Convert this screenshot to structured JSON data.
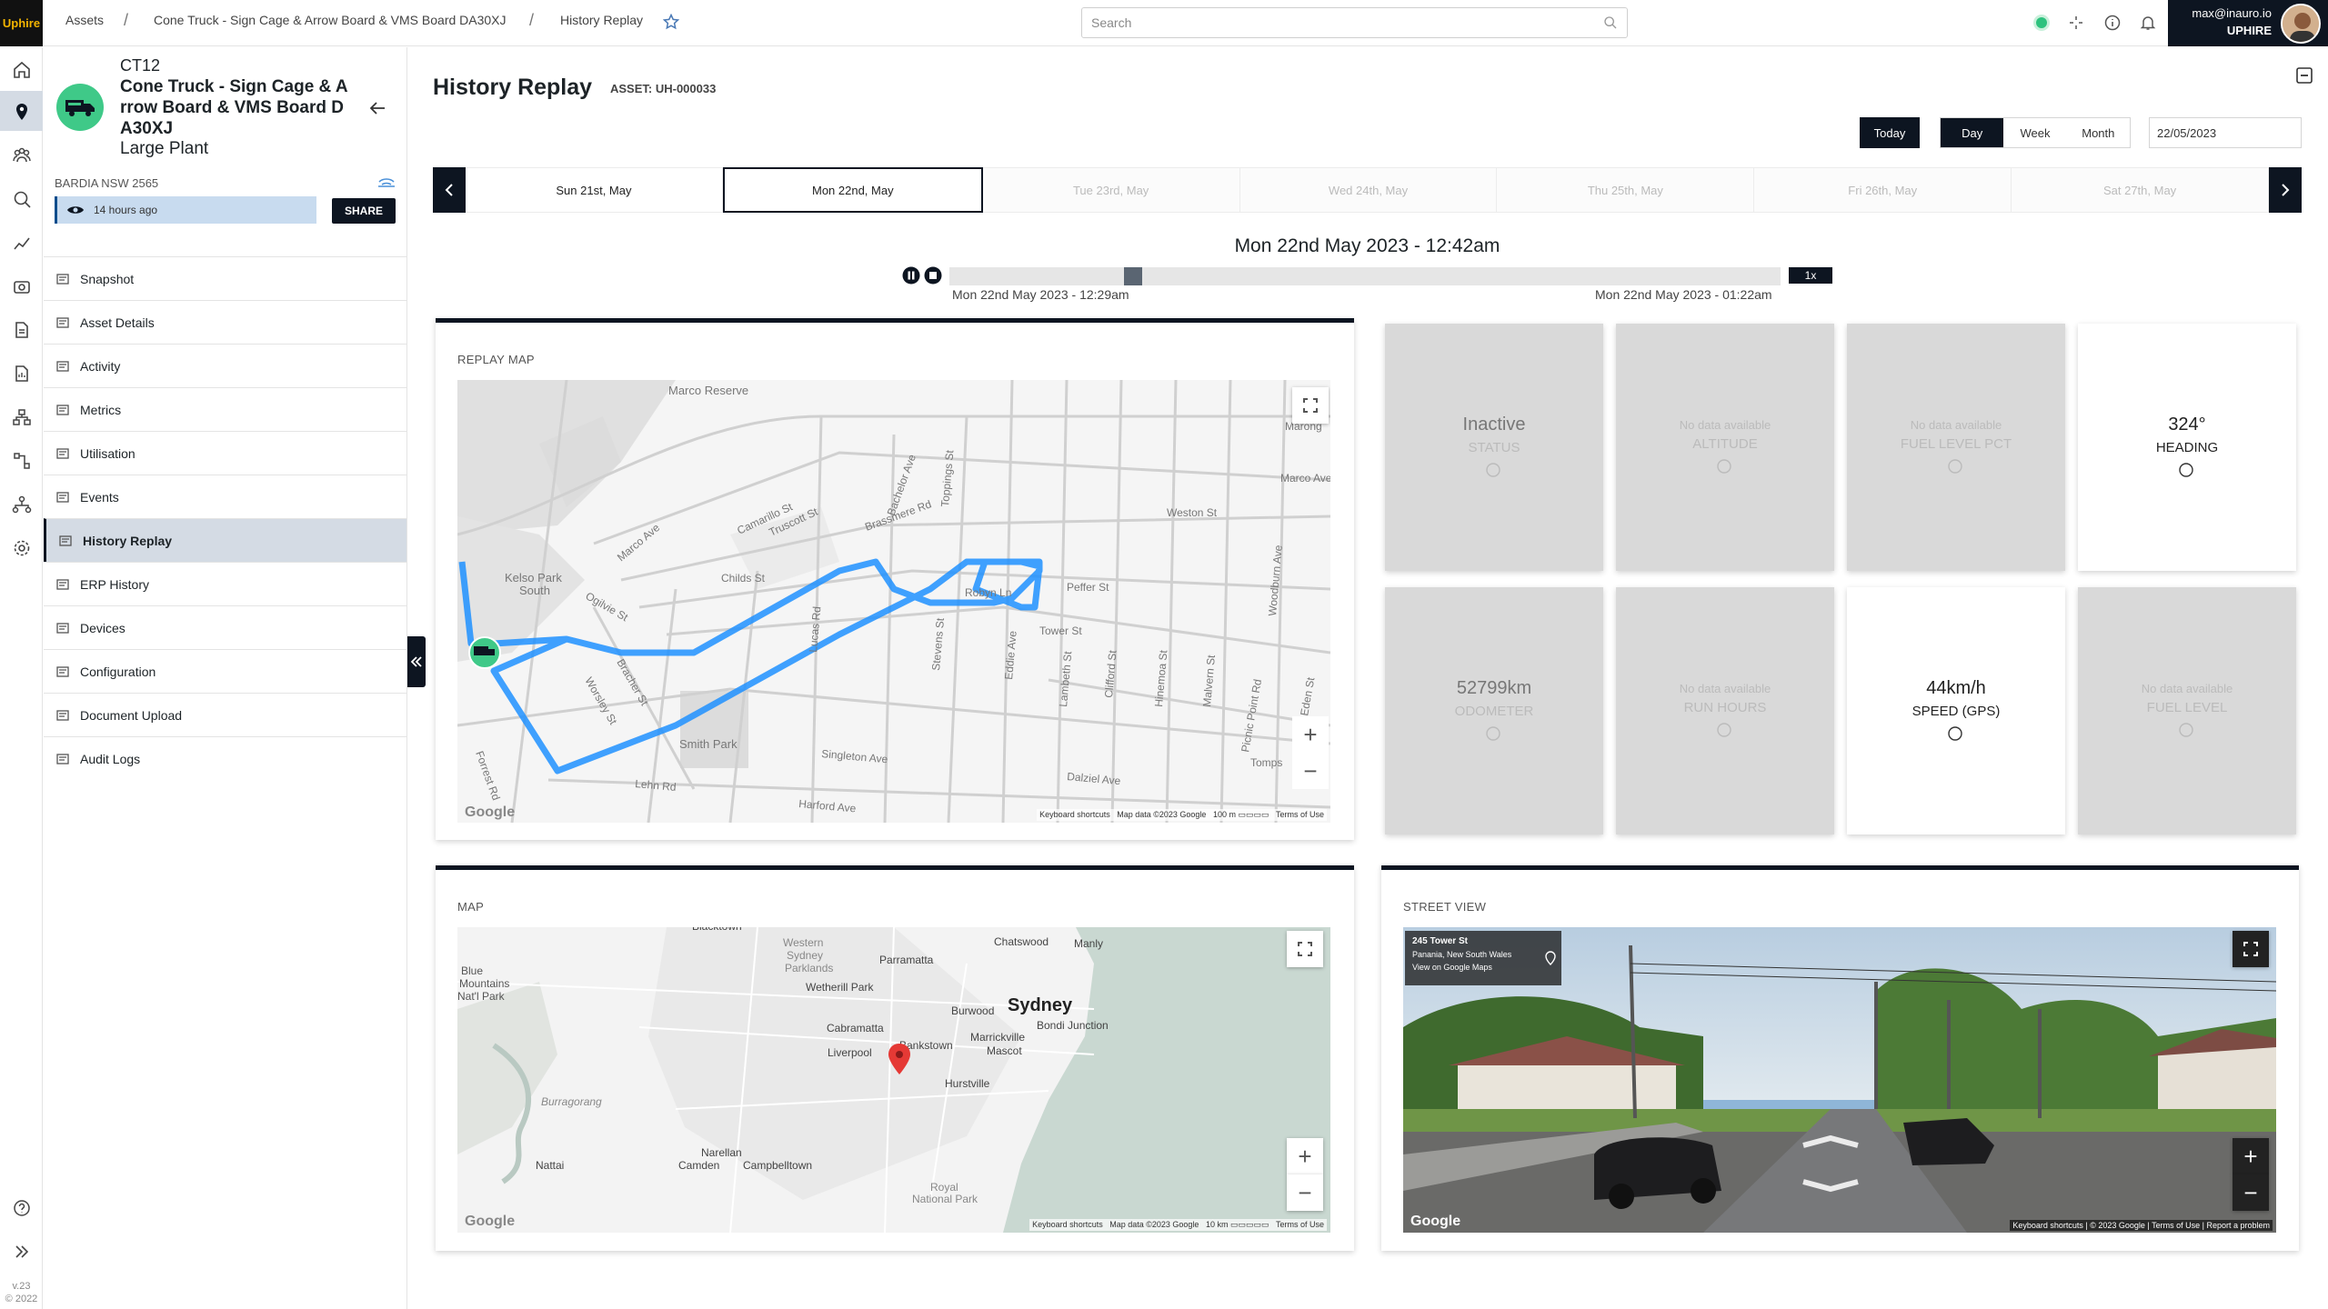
{
  "app": {
    "logo_text": "Uphire"
  },
  "breadcrumb": [
    "Assets",
    "Cone Truck - Sign Cage & Arrow Board & VMS Board DA30XJ",
    "History Replay"
  ],
  "search": {
    "placeholder": "Search"
  },
  "user": {
    "email": "max@inauro.io",
    "org": "UPHIRE"
  },
  "rail": {
    "version": "v.23",
    "copyright": "© 2022"
  },
  "asset": {
    "code": "CT12",
    "name": "Cone Truck - Sign Cage & A rrow Board & VMS Board D A30XJ",
    "type": "Large Plant",
    "location": "BARDIA NSW 2565",
    "last_seen": "14 hours ago",
    "share_label": "SHARE"
  },
  "nav": [
    {
      "label": "Snapshot",
      "icon": "list-icon"
    },
    {
      "label": "Asset Details",
      "icon": "grid-icon"
    },
    {
      "label": "Activity",
      "icon": "activity-icon"
    },
    {
      "label": "Metrics",
      "icon": "metrics-icon"
    },
    {
      "label": "Utilisation",
      "icon": "chart-icon"
    },
    {
      "label": "Events",
      "icon": "bell-icon"
    },
    {
      "label": "History Replay",
      "icon": "clock-icon",
      "active": true
    },
    {
      "label": "ERP History",
      "icon": "table-icon"
    },
    {
      "label": "Devices",
      "icon": "device-icon"
    },
    {
      "label": "Configuration",
      "icon": "config-icon"
    },
    {
      "label": "Document Upload",
      "icon": "upload-icon"
    },
    {
      "label": "Audit Logs",
      "icon": "log-icon"
    }
  ],
  "page": {
    "title": "History Replay",
    "asset_id": "ASSET: UH-000033"
  },
  "range": {
    "today": "Today",
    "day": "Day",
    "week": "Week",
    "month": "Month",
    "date": "22/05/2023",
    "active": "Day"
  },
  "days": [
    "Sun 21st, May",
    "Mon 22nd, May",
    "Tue 23rd, May",
    "Wed 24th, May",
    "Thu 25th, May",
    "Fri 26th, May",
    "Sat 27th, May"
  ],
  "selected_day_index": 1,
  "replay": {
    "current_time": "Mon 22nd May 2023 - 12:42am",
    "start_time": "Mon 22nd May 2023 - 12:29am",
    "end_time": "Mon 22nd May 2023 - 01:22am",
    "speed": "1x",
    "progress": 0.21
  },
  "replay_map": {
    "label": "REPLAY MAP",
    "streets": [
      "Marco Reserve",
      "Camarillo St",
      "Truscott St",
      "Brassmere Rd",
      "Marco Ave",
      "Childs St",
      "Ogilvie St",
      "Kelso Park South",
      "Robyn Ln",
      "Peffer St",
      "Weston St",
      "Tower St",
      "Smith Park",
      "Singleton Ave",
      "Lehn Rd",
      "Harford Ave",
      "Dalziel Ave",
      "Lucas Rd",
      "Stevens St",
      "Eddie Ave",
      "Lambeth St",
      "Clifford St",
      "Hinemoa St",
      "Malvern St",
      "Picnic Point Rd",
      "Woodburn Ave",
      "Marco Ave",
      "Worsley St",
      "Bracher St",
      "Forrest Rd",
      "Toppings St",
      "Bachelor Ave",
      "Tomps",
      "Eden St",
      "Marong"
    ],
    "attribution": [
      "Keyboard shortcuts",
      "Map data ©2023 Google",
      "100 m",
      "Terms of Use"
    ],
    "google": "Google"
  },
  "stats": [
    {
      "value": "Inactive",
      "label": "STATUS",
      "icon": "circle-icon",
      "live": false
    },
    {
      "value": "No data available",
      "label": "ALTITUDE",
      "icon": "battery-icon",
      "live": false,
      "nodata": true
    },
    {
      "value": "No data available",
      "label": "FUEL LEVEL PCT",
      "icon": "fuel-icon",
      "live": false,
      "nodata": true
    },
    {
      "value": "324°",
      "label": "HEADING",
      "icon": "compass-icon",
      "live": true
    },
    {
      "value": "52799km",
      "label": "ODOMETER",
      "icon": "info-icon",
      "live": false
    },
    {
      "value": "No data available",
      "label": "RUN HOURS",
      "icon": "clock-icon",
      "live": false,
      "nodata": true
    },
    {
      "value": "44km/h",
      "label": "SPEED (GPS)",
      "icon": "speed-icon",
      "live": true
    },
    {
      "value": "No data available",
      "label": "FUEL LEVEL",
      "icon": "fuel-icon",
      "live": false,
      "nodata": true
    }
  ],
  "map": {
    "label": "MAP",
    "places": [
      "Blacktown",
      "Western Sydney Parklands",
      "Chatswood",
      "Manly",
      "Parramatta",
      "Wetherill Park",
      "Sydney",
      "Burwood",
      "Bondi Junction",
      "Cabramatta",
      "Bankstown",
      "Marrickville",
      "Liverpool",
      "Mascot",
      "Hurstville",
      "Burragorang",
      "Narellan",
      "Nattai",
      "Camden",
      "Campbelltown",
      "Royal National Park",
      "Blue Mountains Nat'l Park"
    ],
    "attribution": [
      "Keyboard shortcuts",
      "Map data ©2023 Google",
      "10 km",
      "Terms of Use"
    ],
    "google": "Google"
  },
  "street_view": {
    "label": "STREET VIEW",
    "address": "245 Tower St",
    "suburb": "Panania, New South Wales",
    "link": "View on Google Maps",
    "attribution": [
      "Keyboard shortcuts",
      "© 2023 Google",
      "Terms of Use",
      "Report a problem"
    ],
    "google": "Google"
  },
  "colors": {
    "accent": "#0d1521",
    "route": "#1e90ff",
    "marker": "#3fc988",
    "pin": "#e53935"
  }
}
